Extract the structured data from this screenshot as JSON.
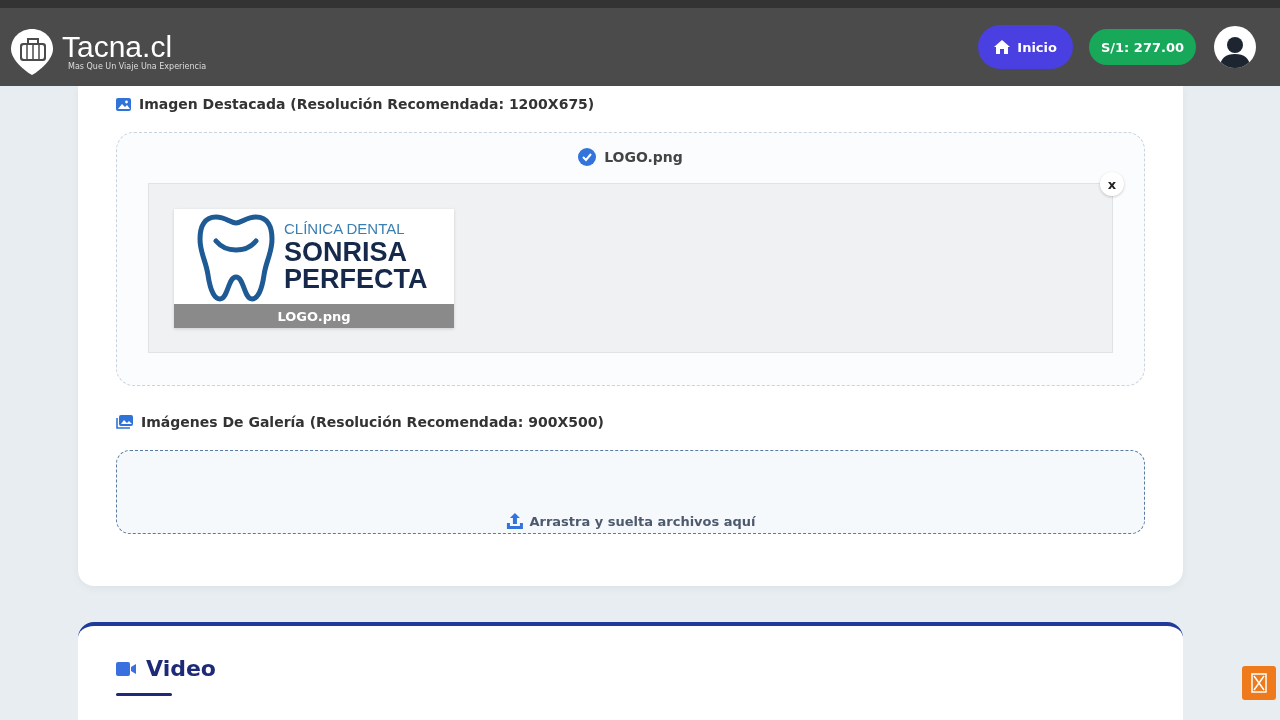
{
  "header": {
    "brand": "Tacna.cl",
    "tagline": "Mas Que Un Viaje Una Experiencia",
    "home_button": "Inicio",
    "balance": "S/1: 277.00"
  },
  "featured_image": {
    "label": "Imagen Destacada (Resolución Recomendada: 1200X675)",
    "uploaded_file": "LOGO.png",
    "close": "x",
    "preview": {
      "logo_lines": [
        "CLÍNICA DENTAL",
        "SONRISA",
        "PERFECTA"
      ],
      "caption": "LOGO.png"
    }
  },
  "gallery": {
    "label": "Imágenes De Galería (Resolución Recomendada: 900X500)",
    "drop_hint": "Arrastra y suelta archivos aquí"
  },
  "video_section": {
    "title": "Video"
  }
}
